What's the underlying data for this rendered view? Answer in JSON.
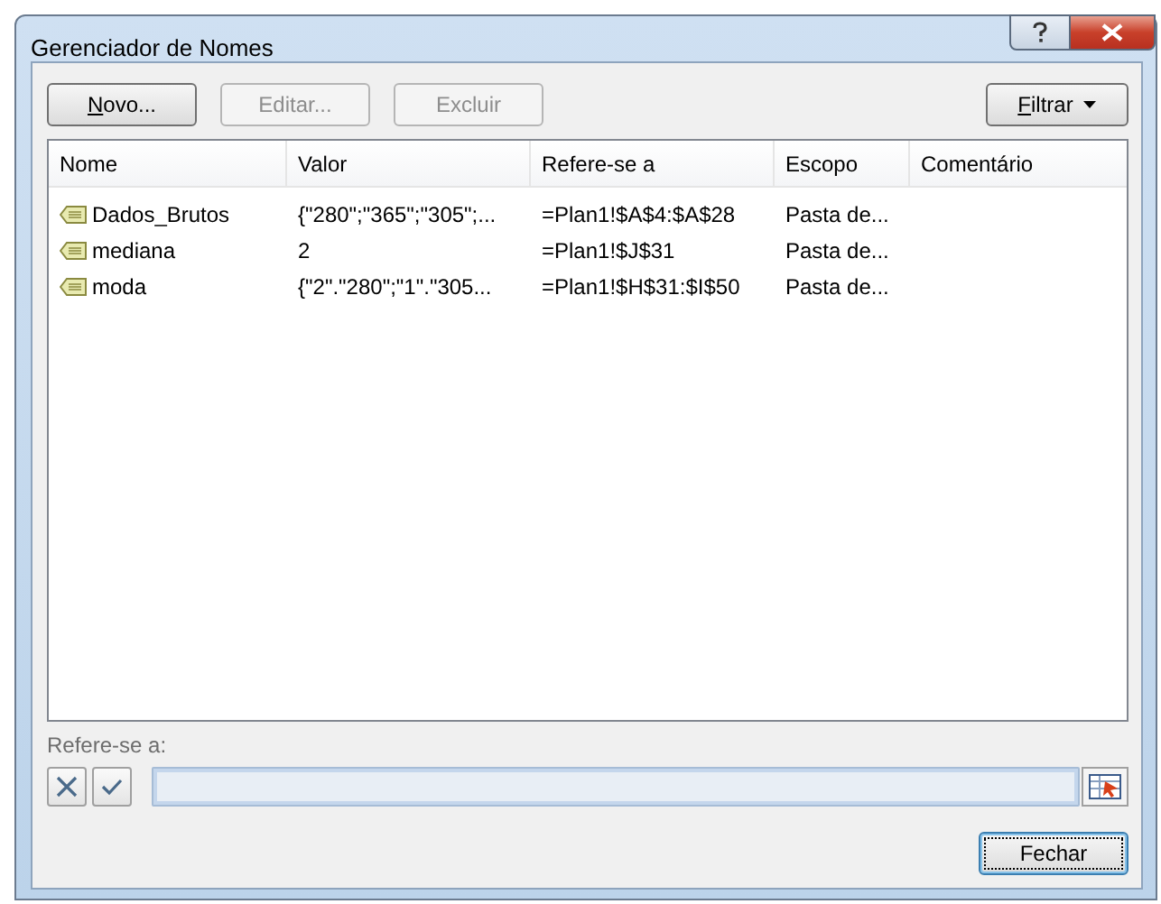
{
  "window": {
    "title": "Gerenciador de Nomes"
  },
  "toolbar": [
    {
      "label": "Novo...",
      "disabled": false,
      "mnemonic": true
    },
    {
      "label": "Editar...",
      "disabled": true,
      "mnemonic": false
    },
    {
      "label": "Excluir",
      "disabled": true,
      "mnemonic": false
    }
  ],
  "filter_button": {
    "label": "Filtrar",
    "mnemonic": true
  },
  "table": {
    "columns": [
      "Nome",
      "Valor",
      "Refere-se a",
      "Escopo",
      "Comentário"
    ],
    "rows": [
      {
        "name": "Dados_Brutos",
        "value": "{\"280\";\"365\";\"305\";...",
        "refers_to": "=Plan1!$A$4:$A$28",
        "scope": "Pasta de..."
      },
      {
        "name": "mediana",
        "value": "2",
        "refers_to": "=Plan1!$J$31",
        "scope": "Pasta de..."
      },
      {
        "name": "moda",
        "value": "{\"2\".\"280\";\"1\".\"305...",
        "refers_to": "=Plan1!$H$31:$I$50",
        "scope": "Pasta de..."
      }
    ]
  },
  "reference": {
    "label": "Refere-se a:"
  },
  "close_button": {
    "label": "Fechar",
    "default": true
  }
}
